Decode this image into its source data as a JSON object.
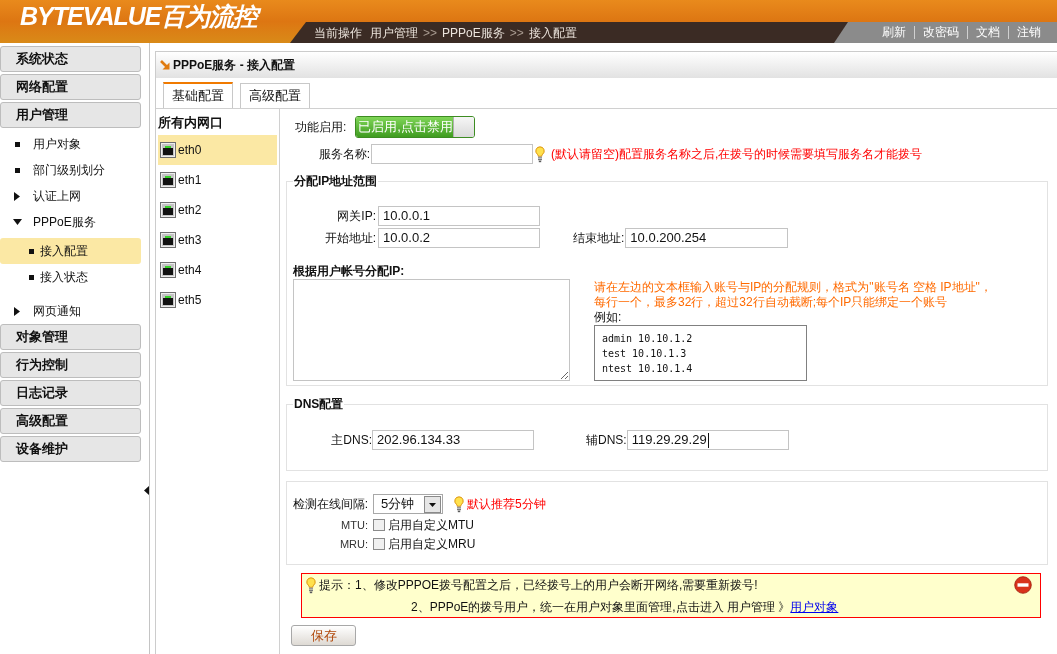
{
  "header": {
    "logo": "BYTEVALUE百为流控",
    "breadcrumb": {
      "label": "当前操作",
      "items": [
        "用户管理",
        "PPPoE服务",
        "接入配置"
      ],
      "separator": ">>"
    },
    "links": [
      "刷新",
      "改密码",
      "文档",
      "注销"
    ]
  },
  "sidebar": {
    "groups": [
      {
        "label": "系统状态"
      },
      {
        "label": "网络配置"
      },
      {
        "label": "用户管理",
        "children": [
          {
            "kind": "leaf",
            "label": "用户对象",
            "selected": false
          },
          {
            "kind": "leaf",
            "label": "部门级别划分",
            "selected": false
          },
          {
            "kind": "folder",
            "label": "认证上网",
            "expanded": false,
            "selected": false
          },
          {
            "kind": "folder",
            "label": "PPPoE服务",
            "expanded": true,
            "selected": false,
            "children": [
              {
                "kind": "leaf",
                "label": "接入配置",
                "selected": true
              },
              {
                "kind": "leaf",
                "label": "接入状态",
                "selected": false
              }
            ]
          },
          {
            "kind": "folder",
            "label": "网页通知",
            "expanded": false,
            "selected": false
          }
        ]
      },
      {
        "label": "对象管理"
      },
      {
        "label": "行为控制"
      },
      {
        "label": "日志记录"
      },
      {
        "label": "高级配置"
      },
      {
        "label": "设备维护"
      }
    ]
  },
  "panel": {
    "title": "PPPoE服务 - 接入配置",
    "tabs": [
      {
        "label": "基础配置",
        "selected": true
      },
      {
        "label": "高级配置",
        "selected": false
      }
    ],
    "interfaces": {
      "heading": "所有内网口",
      "items": [
        {
          "label": "eth0",
          "selected": true
        },
        {
          "label": "eth1",
          "selected": false
        },
        {
          "label": "eth2",
          "selected": false
        },
        {
          "label": "eth3",
          "selected": false
        },
        {
          "label": "eth4",
          "selected": false
        },
        {
          "label": "eth5",
          "selected": false
        }
      ]
    },
    "form": {
      "enable": {
        "label": "功能启用:",
        "on": true,
        "button": "已启用,点击禁用"
      },
      "service_name": {
        "label": "服务名称:",
        "hint": "(默认请留空)配置服务名称之后,在拨号的时候需要填写服务名才能拨号"
      },
      "ip_range": {
        "title": "分配IP地址范围",
        "rows": [
          [
            {
              "label": "网关IP:",
              "value": "10.0.0.1"
            }
          ],
          [
            {
              "label": "开始地址:",
              "value": "10.0.0.2"
            },
            {
              "label": "结束地址:",
              "value": "10.0.200.254"
            }
          ]
        ],
        "account_ip": {
          "label": "根据用户帐号分配IP:",
          "hint": "请在左边的文本框输入账号与IP的分配规则，格式为\"账号名 空格 IP地址\"，每行一个，最多32行，超过32行自动截断;每个IP只能绑定一个账号",
          "example_label": "例如:",
          "example_lines": [
            "admin 10.10.1.2",
            "test 10.10.1.3",
            "ntest 10.10.1.4"
          ]
        }
      },
      "dns": {
        "title": "DNS配置",
        "fields": [
          {
            "label": "主DNS:",
            "value": "202.96.134.33",
            "focused": false
          },
          {
            "label": "辅DNS:",
            "value": "119.29.29.29",
            "focused": true
          }
        ]
      },
      "online_check": {
        "label": "检测在线间隔:",
        "value": "5分钟",
        "hint": "默认推荐5分钟",
        "options": [
          {
            "label": "MTU:",
            "checked": false,
            "text": "启用自定义MTU"
          },
          {
            "label": "MRU:",
            "checked": false,
            "text": "启用自定义MRU"
          }
        ]
      },
      "notice": {
        "label": "提示：",
        "lines": [
          {
            "text": "1、修改PPPOE拨号配置之后，已经拨号上的用户会断开网络,需要重新拨号!"
          },
          {
            "text": "2、PPPoE的拨号用户，统一在用户对象里面管理,点击进入 用户管理 》",
            "link": "用户对象"
          }
        ]
      },
      "save_button": "保存"
    }
  }
}
